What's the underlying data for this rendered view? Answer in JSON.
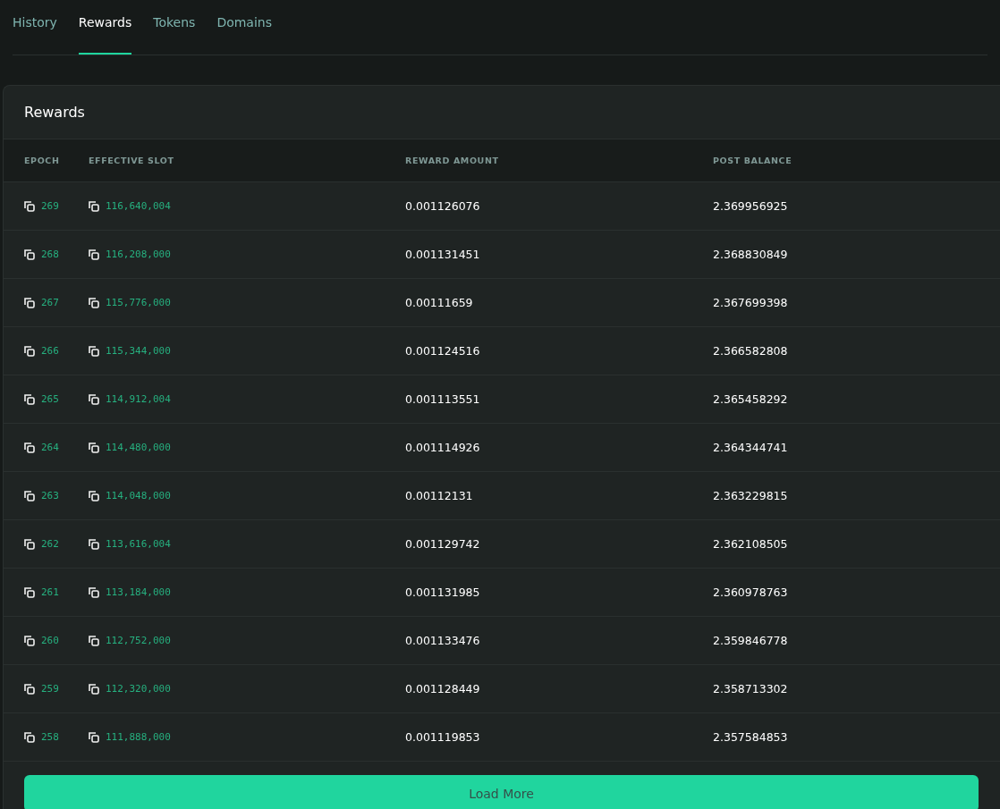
{
  "tabs": [
    {
      "label": "History",
      "selected": false
    },
    {
      "label": "Rewards",
      "selected": true
    },
    {
      "label": "Tokens",
      "selected": false
    },
    {
      "label": "Domains",
      "selected": false
    }
  ],
  "card": {
    "title": "Rewards",
    "table": {
      "columns": [
        "EPOCH",
        "EFFECTIVE SLOT",
        "REWARD AMOUNT",
        "POST BALANCE"
      ],
      "rows": [
        {
          "epoch": "269",
          "slot": "116,640,004",
          "reward": "0.001126076",
          "balance": "2.369956925"
        },
        {
          "epoch": "268",
          "slot": "116,208,000",
          "reward": "0.001131451",
          "balance": "2.368830849"
        },
        {
          "epoch": "267",
          "slot": "115,776,000",
          "reward": "0.00111659",
          "balance": "2.367699398"
        },
        {
          "epoch": "266",
          "slot": "115,344,000",
          "reward": "0.001124516",
          "balance": "2.366582808"
        },
        {
          "epoch": "265",
          "slot": "114,912,004",
          "reward": "0.001113551",
          "balance": "2.365458292"
        },
        {
          "epoch": "264",
          "slot": "114,480,000",
          "reward": "0.001114926",
          "balance": "2.364344741"
        },
        {
          "epoch": "263",
          "slot": "114,048,000",
          "reward": "0.00112131",
          "balance": "2.363229815"
        },
        {
          "epoch": "262",
          "slot": "113,616,004",
          "reward": "0.001129742",
          "balance": "2.362108505"
        },
        {
          "epoch": "261",
          "slot": "113,184,000",
          "reward": "0.001131985",
          "balance": "2.360978763"
        },
        {
          "epoch": "260",
          "slot": "112,752,000",
          "reward": "0.001133476",
          "balance": "2.359846778"
        },
        {
          "epoch": "259",
          "slot": "112,320,000",
          "reward": "0.001128449",
          "balance": "2.358713302"
        },
        {
          "epoch": "258",
          "slot": "111,888,000",
          "reward": "0.001119853",
          "balance": "2.357584853"
        }
      ]
    },
    "load_more": "Load More"
  }
}
